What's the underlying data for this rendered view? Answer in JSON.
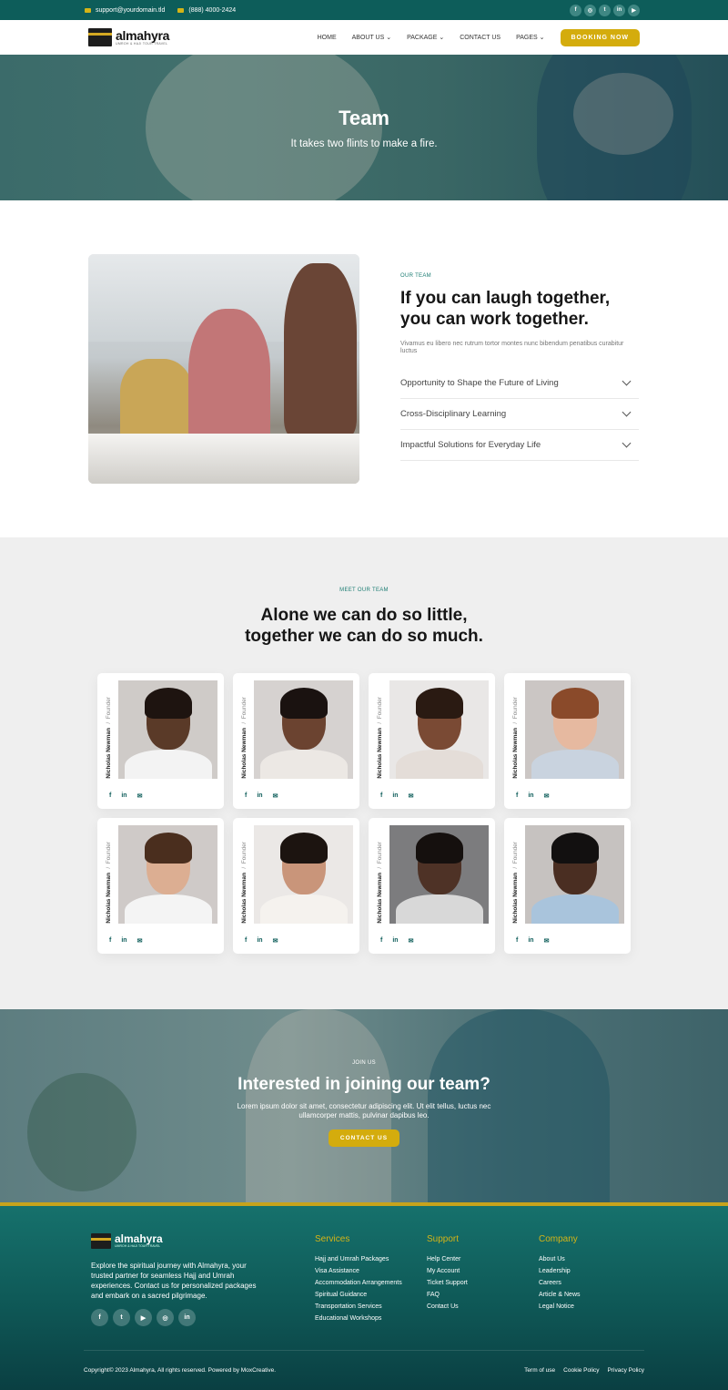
{
  "topbar": {
    "email": "support@yourdomain.tld",
    "phone": "(888) 4000-2424",
    "social": [
      {
        "icon": "facebook-icon",
        "glyph": "f"
      },
      {
        "icon": "instagram-icon",
        "glyph": "◎"
      },
      {
        "icon": "twitter-icon",
        "glyph": "t"
      },
      {
        "icon": "linkedin-icon",
        "glyph": "in"
      },
      {
        "icon": "youtube-icon",
        "glyph": "▶"
      }
    ]
  },
  "header": {
    "brand": "almahyra",
    "tagline": "UMROH & HAJI TOUR TRAVEL",
    "nav": [
      "HOME",
      "ABOUT US",
      "PACKAGE",
      "CONTACT US",
      "PAGES"
    ],
    "cta": "BOOKING NOW"
  },
  "hero": {
    "title": "Team",
    "subtitle": "It takes two flints to make a fire."
  },
  "about": {
    "eyebrow": "OUR TEAM",
    "heading_line1": "If you can laugh together,",
    "heading_line2": "you can work together.",
    "description": "Vivamus eu libero nec rutrum tortor montes nunc bibendum penatibus curabitur luctus",
    "accordion": [
      "Opportunity to Shape the Future of Living",
      "Cross-Disciplinary Learning",
      "Impactful Solutions for Everyday Life"
    ]
  },
  "team": {
    "eyebrow": "MEET OUR TEAM",
    "heading_line1": "Alone we can do so little,",
    "heading_line2": "together we can do so much.",
    "members": [
      {
        "name": "Nicholas Newman",
        "role": "Founder"
      },
      {
        "name": "Nicholas Newman",
        "role": "Founder"
      },
      {
        "name": "Nicholas Newman",
        "role": "Founder"
      },
      {
        "name": "Nicholas Newman",
        "role": "Founder"
      },
      {
        "name": "Nicholas Newman",
        "role": "Founder"
      },
      {
        "name": "Nicholas Newman",
        "role": "Founder"
      },
      {
        "name": "Nicholas Newman",
        "role": "Founder"
      },
      {
        "name": "Nicholas Newman",
        "role": "Founder"
      }
    ]
  },
  "join": {
    "eyebrow": "JOIN US",
    "heading": "Interested in joining our team?",
    "text": "Lorem ipsum dolor sit amet, consectetur adipiscing elit. Ut elit tellus, luctus nec ullamcorper mattis, pulvinar dapibus leo.",
    "cta": "CONTACT US"
  },
  "footer": {
    "brand": "almahyra",
    "tagline": "UMROH & HAJI TOUR TRAVEL",
    "about": "Explore the spiritual journey with Almahyra, your trusted partner for seamless Hajj and Umrah experiences. Contact us for personalized packages and embark on a sacred pilgrimage.",
    "columns": [
      {
        "title": "Services",
        "links": [
          "Hajj and Umrah Packages",
          "Visa Assistance",
          "Accommodation Arrangements",
          "Spiritual Guidance",
          "Transportation Services",
          "Educational Workshops"
        ]
      },
      {
        "title": "Support",
        "links": [
          "Help Center",
          "My Account",
          "Ticket Support",
          "FAQ",
          "Contact Us"
        ]
      },
      {
        "title": "Company",
        "links": [
          "About Us",
          "Leadership",
          "Careers",
          "Article & News",
          "Legal Notice"
        ]
      }
    ],
    "copyright": "Copyright© 2023 Almahyra, All rights reserved. Powered by MoxCreative.",
    "legal": [
      "Term of use",
      "Cookie Policy",
      "Privacy Policy"
    ]
  }
}
